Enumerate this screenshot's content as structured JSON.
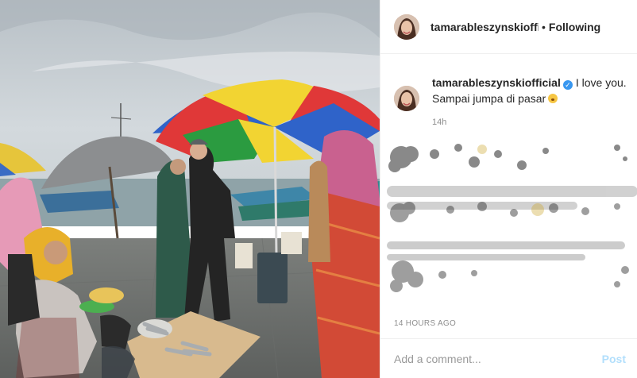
{
  "post": {
    "photo": {
      "alt": "market photo"
    },
    "header": {
      "username": "tamarableszynskiofficial",
      "separator": "•",
      "follow_status": "Following"
    },
    "caption": {
      "username": "tamarableszynskiofficial",
      "verified_glyph": "✓",
      "line1": "I love you.",
      "line2": "Sampai jumpa di pasar",
      "emoji_name": "astonished-emoji",
      "relative_time": "14h"
    },
    "timestamp": "14 HOURS AGO",
    "comment": {
      "placeholder": "Add a comment...",
      "post_label": "Post"
    }
  },
  "colors": {
    "link_blue": "#3897f0",
    "post_disabled": "#b2dffc",
    "muted": "#8e8e8e",
    "text": "#262626",
    "border": "#efefef"
  }
}
